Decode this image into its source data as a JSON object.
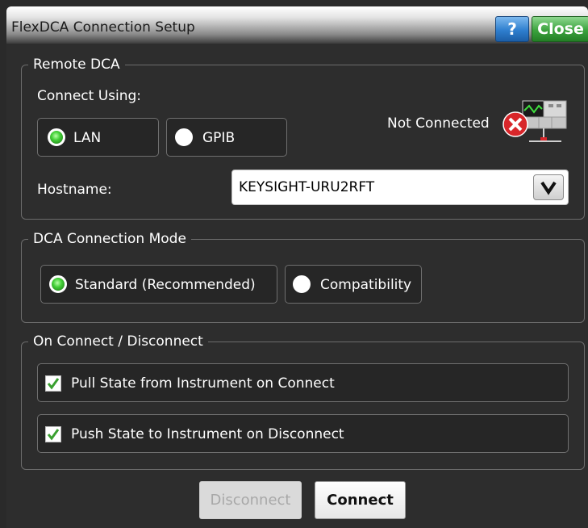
{
  "window": {
    "title": "FlexDCA Connection Setup",
    "help_label": "?",
    "close_label": "Close"
  },
  "remote_dca": {
    "legend": "Remote DCA",
    "connect_using_label": "Connect Using:",
    "options": [
      {
        "label": "LAN",
        "selected": true
      },
      {
        "label": "GPIB",
        "selected": false
      }
    ],
    "status_text": "Not Connected",
    "status_icon": "network-disconnected-icon",
    "hostname_label": "Hostname:",
    "hostname_value": "KEYSIGHT-URU2RFT"
  },
  "connection_mode": {
    "legend": "DCA Connection Mode",
    "options": [
      {
        "label": "Standard (Recommended)",
        "selected": true
      },
      {
        "label": "Compatibility",
        "selected": false
      }
    ]
  },
  "on_connect": {
    "legend": "On Connect / Disconnect",
    "items": [
      {
        "label": "Pull State from Instrument on Connect",
        "checked": true
      },
      {
        "label": "Push State to Instrument on Disconnect",
        "checked": true
      }
    ]
  },
  "actions": {
    "disconnect_label": "Disconnect",
    "connect_label": "Connect"
  },
  "colors": {
    "background": "#2d2d2d",
    "radio_selected": "#43d037",
    "checkmark": "#3aa030",
    "help_blue": "#2f7fcf",
    "close_green": "#3ca33e",
    "error_red": "#d8262a"
  }
}
